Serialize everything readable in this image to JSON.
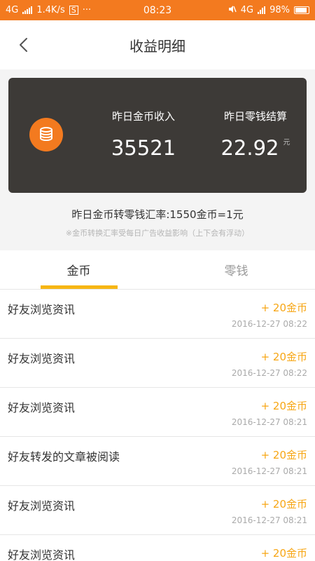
{
  "status_bar": {
    "network": "4G",
    "speed": "1.4K/s",
    "app_badge": "S",
    "dots": "···",
    "time": "08:23",
    "network_right": "4G",
    "battery": "98%"
  },
  "nav": {
    "title": "收益明细",
    "back_icon": "chevron-left-icon"
  },
  "summary": {
    "gold_label": "昨日金币收入",
    "gold_value": "35521",
    "cash_label": "昨日零钱结算",
    "cash_value": "22.92",
    "cash_unit": "元",
    "icon": "coin-stack-icon",
    "card_color": "#3d3a37",
    "accent_color": "#f37a1f"
  },
  "rate": {
    "text": "昨日金币转零钱汇率:1550金币=1元",
    "note": "※金币转换汇率受每日广告收益影响（上下会有浮动）"
  },
  "tabs": [
    {
      "label": "金币",
      "active": true
    },
    {
      "label": "零钱",
      "active": false
    }
  ],
  "records": [
    {
      "title": "好友浏览资讯",
      "amount": "+ 20金币",
      "time": "2016-12-27 08:22"
    },
    {
      "title": "好友浏览资讯",
      "amount": "+ 20金币",
      "time": "2016-12-27 08:22"
    },
    {
      "title": "好友浏览资讯",
      "amount": "+ 20金币",
      "time": "2016-12-27 08:21"
    },
    {
      "title": "好友转发的文章被阅读",
      "amount": "+ 20金币",
      "time": "2016-12-27 08:21"
    },
    {
      "title": "好友浏览资讯",
      "amount": "+ 20金币",
      "time": "2016-12-27 08:21"
    },
    {
      "title": "好友浏览资讯",
      "amount": "+ 20金币",
      "time": ""
    }
  ]
}
